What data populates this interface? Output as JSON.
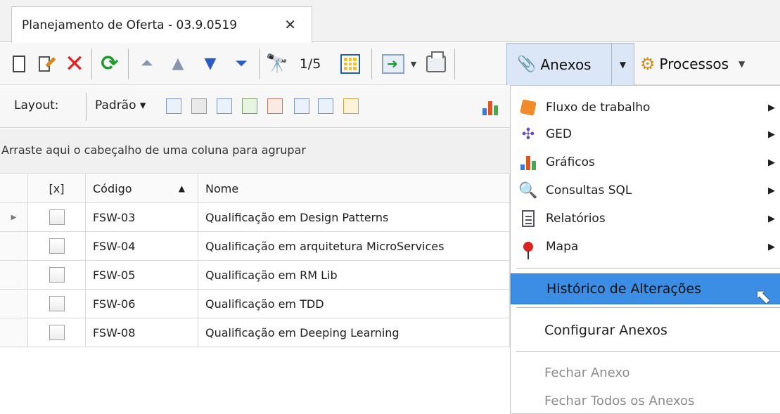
{
  "tab": {
    "title": "Planejamento de Oferta - 03.9.0519",
    "close": "✕"
  },
  "toolbar": {
    "pager": "1/5",
    "anexos_label": "Anexos",
    "processos_label": "Processos"
  },
  "layoutbar": {
    "layout_label": "Layout:",
    "padrao_label": "Padrão ▾"
  },
  "grid": {
    "group_hint": "Arraste aqui o cabeçalho de uma coluna para agrupar",
    "columns": [
      "[x]",
      "Código",
      "Nome"
    ],
    "rows": [
      {
        "codigo": "FSW-03",
        "nome": "Qualificação em Design Patterns"
      },
      {
        "codigo": "FSW-04",
        "nome": "Qualificação em arquitetura MicroServices"
      },
      {
        "codigo": "FSW-05",
        "nome": "Qualificação em RM Lib"
      },
      {
        "codigo": "FSW-06",
        "nome": "Qualificação em TDD"
      },
      {
        "codigo": "FSW-08",
        "nome": "Qualificação em Deeping Learning"
      }
    ]
  },
  "menu": {
    "items": [
      {
        "label": "Fluxo de trabalho",
        "icon": "workflow-icon"
      },
      {
        "label": "GED",
        "icon": "ged-icon"
      },
      {
        "label": "Gráficos",
        "icon": "chart-icon"
      },
      {
        "label": "Consultas SQL",
        "icon": "sql-query-icon"
      },
      {
        "label": "Relatórios",
        "icon": "report-icon"
      },
      {
        "label": "Mapa",
        "icon": "map-pin-icon"
      }
    ],
    "historico": "Histórico de Alterações",
    "configurar": "Configurar Anexos",
    "fechar": "Fechar Anexo",
    "fechar_todos": "Fechar Todos os Anexos"
  },
  "colors": {
    "highlight": "#3c8de4",
    "delete": "#e02424",
    "refresh": "#1f9a2b"
  }
}
